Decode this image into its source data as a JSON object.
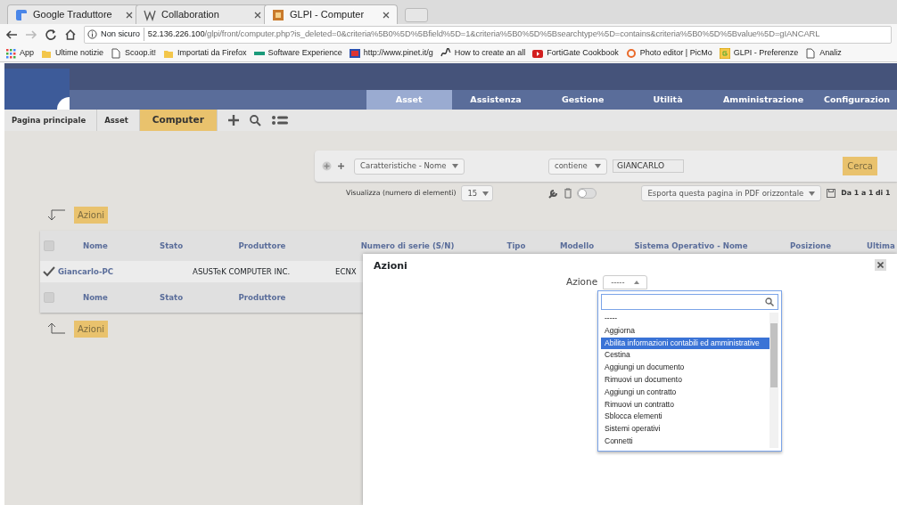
{
  "browser": {
    "tabs": [
      {
        "title": "Google Traduttore",
        "selected": false
      },
      {
        "title": "Collaboration",
        "selected": false
      },
      {
        "title": "GLPI - Computer",
        "selected": true
      }
    ],
    "security": "Non sicuro",
    "url_host": "52.136.226.100",
    "url_path": "/glpi/front/computer.php?is_deleted=0&criteria%5B0%5D%5Bfield%5D=1&criteria%5B0%5D%5Bsearchtype%5D=contains&criteria%5B0%5D%5Bvalue%5D=gIANCARL",
    "bookmarks": [
      {
        "label": "App",
        "kind": "apps"
      },
      {
        "label": "Ultime notizie",
        "kind": "folder"
      },
      {
        "label": "Scoop.it!",
        "kind": "page"
      },
      {
        "label": "Importati da Firefox",
        "kind": "folder"
      },
      {
        "label": "Software Experience",
        "kind": "bar"
      },
      {
        "label": "http://www.pinet.it/g",
        "kind": "flag"
      },
      {
        "label": "How to create an all",
        "kind": "squiggle"
      },
      {
        "label": "FortiGate Cookbook",
        "kind": "play"
      },
      {
        "label": "Photo editor | PicMo",
        "kind": "swirl"
      },
      {
        "label": "GLPI - Preferenze",
        "kind": "glpi"
      },
      {
        "label": "Analiz",
        "kind": "page"
      }
    ]
  },
  "menu": [
    {
      "label": "Asset",
      "selected": true
    },
    {
      "label": "Assistenza",
      "selected": false
    },
    {
      "label": "Gestione",
      "selected": false
    },
    {
      "label": "Utilità",
      "selected": false
    },
    {
      "label": "Amministrazione",
      "selected": false
    },
    {
      "label": "Configurazion",
      "selected": false
    }
  ],
  "breadcrumb": [
    {
      "label": "Pagina principale",
      "selected": false
    },
    {
      "label": "Asset",
      "selected": false
    },
    {
      "label": "Computer",
      "selected": true
    }
  ],
  "search": {
    "field": "Caratteristiche - Nome",
    "searchtype": "contiene",
    "value": "GIANCARLO",
    "submit": "Cerca"
  },
  "display": {
    "label": "Visualizza (numero di elementi)",
    "count": "15",
    "toggle_on": false,
    "export": "Esporta questa pagina in PDF orizzontale",
    "pager": "Da 1 a 1 di 1"
  },
  "actions_button": "Azioni",
  "table": {
    "columns": [
      "Nome",
      "Stato",
      "Produttore",
      "Numero di serie (S/N)",
      "Tipo",
      "Modello",
      "Sistema Operativo - Nome",
      "Posizione",
      "Ultima"
    ],
    "header_checked": false,
    "rows": [
      {
        "cells": [
          "Giancarlo-PC",
          "",
          "ASUSTeK COMPUTER INC.",
          "ECNX"
        ]
      }
    ],
    "footer_columns": [
      "Nome",
      "Stato",
      "Produttore"
    ],
    "footer_checked": false
  },
  "bottom_actions_button": "Azioni",
  "modal": {
    "title": "Azioni",
    "field_label": "Azione",
    "field_value": "-----",
    "options": [
      {
        "label": "-----",
        "selected": false
      },
      {
        "label": "Aggiorna",
        "selected": false
      },
      {
        "label": "Abilita informazioni contabili ed amministrative",
        "selected": true
      },
      {
        "label": "Cestina",
        "selected": false
      },
      {
        "label": "Aggiungi un documento",
        "selected": false
      },
      {
        "label": "Rimuovi un documento",
        "selected": false
      },
      {
        "label": "Aggiungi un contratto",
        "selected": false
      },
      {
        "label": "Rimuovi un contratto",
        "selected": false
      },
      {
        "label": "Sblocca elementi",
        "selected": false
      },
      {
        "label": "Sistemi operativi",
        "selected": false
      },
      {
        "label": "Connetti",
        "selected": false
      }
    ]
  }
}
